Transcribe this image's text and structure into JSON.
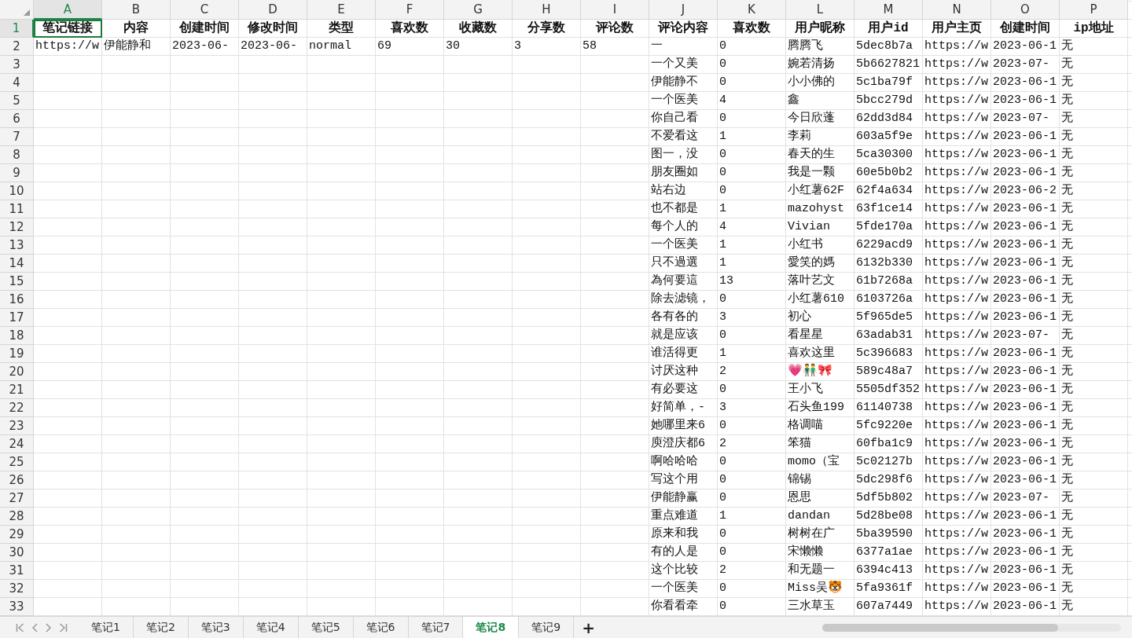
{
  "columns": [
    {
      "letter": "A",
      "selected": true
    },
    {
      "letter": "B",
      "selected": false
    },
    {
      "letter": "C",
      "selected": false
    },
    {
      "letter": "D",
      "selected": false
    },
    {
      "letter": "E",
      "selected": false
    },
    {
      "letter": "F",
      "selected": false
    },
    {
      "letter": "G",
      "selected": false
    },
    {
      "letter": "H",
      "selected": false
    },
    {
      "letter": "I",
      "selected": false
    },
    {
      "letter": "J",
      "selected": false
    },
    {
      "letter": "K",
      "selected": false
    },
    {
      "letter": "L",
      "selected": false
    },
    {
      "letter": "M",
      "selected": false
    },
    {
      "letter": "N",
      "selected": false
    },
    {
      "letter": "O",
      "selected": false
    },
    {
      "letter": "P",
      "selected": false
    }
  ],
  "rows": [
    {
      "number": "1",
      "kind": "header",
      "selected": true,
      "cells": {
        "A": "笔记链接",
        "B": "内容",
        "C": "创建时间",
        "D": "修改时间",
        "E": "类型",
        "F": "喜欢数",
        "G": "收藏数",
        "H": "分享数",
        "I": "评论数",
        "J": "评论内容",
        "K": "喜欢数",
        "L": "用户昵称",
        "M": "用户id",
        "N": "用户主页",
        "O": "创建时间",
        "P": "ip地址"
      }
    },
    {
      "number": "2",
      "kind": "data",
      "selected": false,
      "cells": {
        "A": "https://w",
        "B": "伊能静和",
        "C": "2023-06-",
        "D": "2023-06-",
        "E": "normal",
        "F": "69",
        "G": "30",
        "H": "3",
        "I": "58",
        "J": "一",
        "K": "0",
        "L": "腾腾飞",
        "M": "5dec8b7a",
        "N": "https://w",
        "O": "2023-06-1",
        "P": "无"
      }
    },
    {
      "number": "3",
      "kind": "data",
      "selected": false,
      "cells": {
        "J": "一个又美",
        "K": "0",
        "L": "婉若清扬",
        "M": "5b6627821",
        "N": "https://w",
        "O": "2023-07-",
        "P": "无"
      }
    },
    {
      "number": "4",
      "kind": "data",
      "selected": false,
      "cells": {
        "J": "伊能静不",
        "K": "0",
        "L": "小小佛的",
        "M": "5c1ba79f",
        "N": "https://w",
        "O": "2023-06-1",
        "P": "无"
      }
    },
    {
      "number": "5",
      "kind": "data",
      "selected": false,
      "cells": {
        "J": "一个医美",
        "K": "4",
        "L": "鑫",
        "M": "5bcc279d",
        "N": "https://w",
        "O": "2023-06-1",
        "P": "无"
      }
    },
    {
      "number": "6",
      "kind": "data",
      "selected": false,
      "cells": {
        "J": "你自己看",
        "K": "0",
        "L": "今日欣蓬",
        "M": "62dd3d84",
        "N": "https://w",
        "O": "2023-07-",
        "P": "无"
      }
    },
    {
      "number": "7",
      "kind": "data",
      "selected": false,
      "cells": {
        "J": "不爱看这",
        "K": "1",
        "L": "李莉",
        "M": "603a5f9e",
        "N": "https://w",
        "O": "2023-06-1",
        "P": "无"
      }
    },
    {
      "number": "8",
      "kind": "data",
      "selected": false,
      "cells": {
        "J": "图一，没",
        "K": "0",
        "L": "春天的生",
        "M": "5ca30300",
        "N": "https://w",
        "O": "2023-06-1",
        "P": "无"
      }
    },
    {
      "number": "9",
      "kind": "data",
      "selected": false,
      "cells": {
        "J": "朋友圈如",
        "K": "0",
        "L": "我是一颗",
        "M": "60e5b0b2",
        "N": "https://w",
        "O": "2023-06-1",
        "P": "无"
      }
    },
    {
      "number": "10",
      "kind": "data",
      "selected": false,
      "cells": {
        "J": "站右边",
        "K": "0",
        "L": "小红薯62F",
        "M": "62f4a634",
        "N": "https://w",
        "O": "2023-06-2",
        "P": "无"
      }
    },
    {
      "number": "11",
      "kind": "data",
      "selected": false,
      "cells": {
        "J": "也不都是",
        "K": "1",
        "L": "mazohyst",
        "M": "63f1ce14",
        "N": "https://w",
        "O": "2023-06-1",
        "P": "无"
      }
    },
    {
      "number": "12",
      "kind": "data",
      "selected": false,
      "cells": {
        "J": "每个人的",
        "K": "4",
        "L": "Vivian",
        "M": "5fde170a",
        "N": "https://w",
        "O": "2023-06-1",
        "P": "无"
      }
    },
    {
      "number": "13",
      "kind": "data",
      "selected": false,
      "cells": {
        "J": "一个医美",
        "K": "1",
        "L": "小红书",
        "M": "6229acd9",
        "N": "https://w",
        "O": "2023-06-1",
        "P": "无"
      }
    },
    {
      "number": "14",
      "kind": "data",
      "selected": false,
      "cells": {
        "J": "只不過選",
        "K": "1",
        "L": "愛笑的媽",
        "M": "6132b330",
        "N": "https://w",
        "O": "2023-06-1",
        "P": "无"
      }
    },
    {
      "number": "15",
      "kind": "data",
      "selected": false,
      "cells": {
        "J": "為何要這",
        "K": "13",
        "L": "落叶艺文",
        "M": "61b7268a",
        "N": "https://w",
        "O": "2023-06-1",
        "P": "无"
      }
    },
    {
      "number": "16",
      "kind": "data",
      "selected": false,
      "cells": {
        "J": "除去滤镜，",
        "K": "0",
        "L": "小红薯610",
        "M": "6103726a",
        "N": "https://w",
        "O": "2023-06-1",
        "P": "无"
      }
    },
    {
      "number": "17",
      "kind": "data",
      "selected": false,
      "cells": {
        "J": "各有各的",
        "K": "3",
        "L": "初心",
        "M": "5f965de5",
        "N": "https://w",
        "O": "2023-06-1",
        "P": "无"
      }
    },
    {
      "number": "18",
      "kind": "data",
      "selected": false,
      "cells": {
        "J": "就是应该",
        "K": "0",
        "L": "看星星",
        "M": "63adab31",
        "N": "https://w",
        "O": "2023-07-",
        "P": "无"
      }
    },
    {
      "number": "19",
      "kind": "data",
      "selected": false,
      "cells": {
        "J": "谁活得更",
        "K": "1",
        "L": "喜欢这里",
        "M": "5c396683",
        "N": "https://w",
        "O": "2023-06-1",
        "P": "无"
      }
    },
    {
      "number": "20",
      "kind": "data",
      "selected": false,
      "cells": {
        "J": "讨厌这种",
        "K": "2",
        "L": "💗👬🎀",
        "M": "589c48a7",
        "N": "https://w",
        "O": "2023-06-1",
        "P": "无"
      }
    },
    {
      "number": "21",
      "kind": "data",
      "selected": false,
      "cells": {
        "J": "有必要这",
        "K": "0",
        "L": "王小飞",
        "M": "5505df352",
        "N": "https://w",
        "O": "2023-06-1",
        "P": "无"
      }
    },
    {
      "number": "22",
      "kind": "data",
      "selected": false,
      "cells": {
        "J": "好简单，-",
        "K": "3",
        "L": "石头鱼199",
        "M": "61140738",
        "N": "https://w",
        "O": "2023-06-1",
        "P": "无"
      }
    },
    {
      "number": "23",
      "kind": "data",
      "selected": false,
      "cells": {
        "J": "她哪里来6",
        "K": "0",
        "L": "格调喵",
        "M": "5fc9220e",
        "N": "https://w",
        "O": "2023-06-1",
        "P": "无"
      }
    },
    {
      "number": "24",
      "kind": "data",
      "selected": false,
      "cells": {
        "J": "庾澄庆都6",
        "K": "2",
        "L": "笨猫",
        "M": "60fba1c9",
        "N": "https://w",
        "O": "2023-06-1",
        "P": "无"
      }
    },
    {
      "number": "25",
      "kind": "data",
      "selected": false,
      "cells": {
        "J": "啊哈哈哈",
        "K": "0",
        "L": "momo（宝",
        "M": "5c02127b",
        "N": "https://w",
        "O": "2023-06-1",
        "P": "无"
      }
    },
    {
      "number": "26",
      "kind": "data",
      "selected": false,
      "cells": {
        "J": "写这个用",
        "K": "0",
        "L": "锦锡",
        "M": "5dc298f6",
        "N": "https://w",
        "O": "2023-06-1",
        "P": "无"
      }
    },
    {
      "number": "27",
      "kind": "data",
      "selected": false,
      "cells": {
        "J": "伊能静赢",
        "K": "0",
        "L": "恩思",
        "M": "5df5b802",
        "N": "https://w",
        "O": "2023-07-",
        "P": "无"
      }
    },
    {
      "number": "28",
      "kind": "data",
      "selected": false,
      "cells": {
        "J": "重点难道",
        "K": "1",
        "L": "dandan",
        "M": "5d28be08",
        "N": "https://w",
        "O": "2023-06-1",
        "P": "无"
      }
    },
    {
      "number": "29",
      "kind": "data",
      "selected": false,
      "cells": {
        "J": "原来和我",
        "K": "0",
        "L": "树树在广",
        "M": "5ba39590",
        "N": "https://w",
        "O": "2023-06-1",
        "P": "无"
      }
    },
    {
      "number": "30",
      "kind": "data",
      "selected": false,
      "cells": {
        "J": "有的人是",
        "K": "0",
        "L": "宋懒懒",
        "M": "6377a1ae",
        "N": "https://w",
        "O": "2023-06-1",
        "P": "无"
      }
    },
    {
      "number": "31",
      "kind": "data",
      "selected": false,
      "cells": {
        "J": "这个比较",
        "K": "2",
        "L": "和无题一",
        "M": "6394c413",
        "N": "https://w",
        "O": "2023-06-1",
        "P": "无"
      }
    },
    {
      "number": "32",
      "kind": "data",
      "selected": false,
      "cells": {
        "J": "一个医美",
        "K": "0",
        "L": "Miss吴🐯",
        "M": "5fa9361f",
        "N": "https://w",
        "O": "2023-06-1",
        "P": "无"
      }
    },
    {
      "number": "33",
      "kind": "data",
      "selected": false,
      "cells": {
        "J": "你看看牵",
        "K": "0",
        "L": "三水草玉",
        "M": "607a7449",
        "N": "https://w",
        "O": "2023-06-1",
        "P": "无"
      }
    }
  ],
  "sheet_tabs": [
    {
      "label": "笔记1",
      "selected": false
    },
    {
      "label": "笔记2",
      "selected": false
    },
    {
      "label": "笔记3",
      "selected": false
    },
    {
      "label": "笔记4",
      "selected": false
    },
    {
      "label": "笔记5",
      "selected": false
    },
    {
      "label": "笔记6",
      "selected": false
    },
    {
      "label": "笔记7",
      "selected": false
    },
    {
      "label": "笔记8",
      "selected": true
    },
    {
      "label": "笔记9",
      "selected": false
    }
  ],
  "add_sheet": "+"
}
